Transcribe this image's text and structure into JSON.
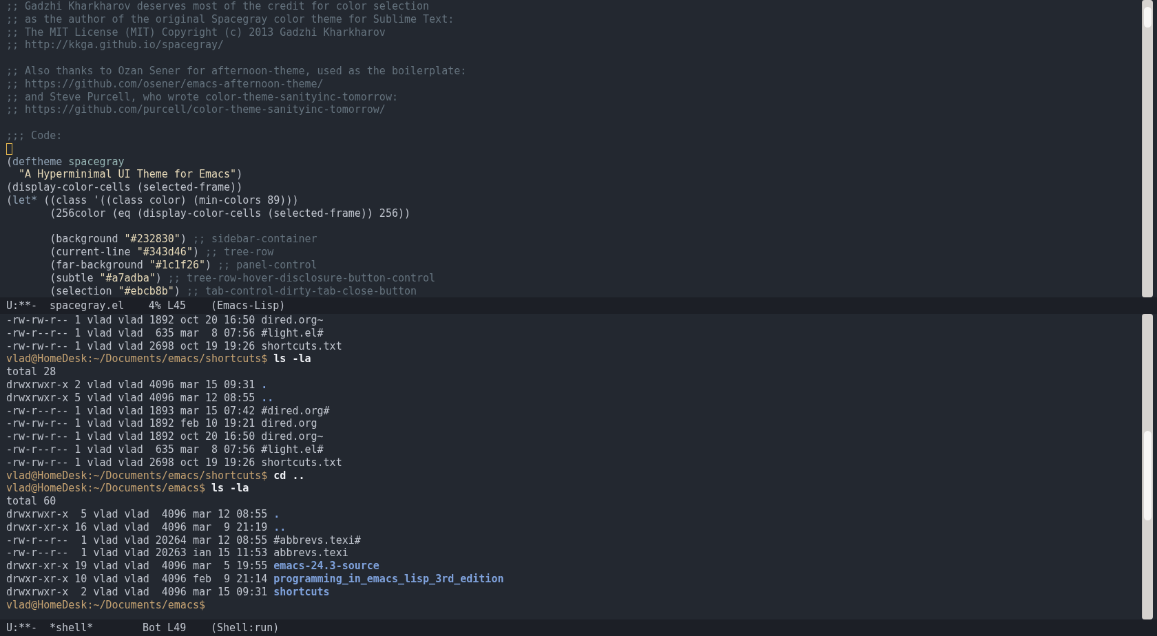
{
  "editor": {
    "lines": [
      {
        "kind": "text",
        "segments": [
          {
            "kind": "comment",
            "text": ";; Gadzhi Kharkharov deserves most of the credit for color selection"
          }
        ]
      },
      {
        "kind": "text",
        "segments": [
          {
            "kind": "comment",
            "text": ";; as the author of the original Spacegray color theme for Sublime Text:"
          }
        ]
      },
      {
        "kind": "text",
        "segments": [
          {
            "kind": "comment",
            "text": ";; The MIT License (MIT) Copyright (c) 2013 Gadzhi Kharkharov"
          }
        ]
      },
      {
        "kind": "text",
        "segments": [
          {
            "kind": "comment",
            "text": ";; http://kkga.github.io/spacegray/"
          }
        ]
      },
      {
        "kind": "blank"
      },
      {
        "kind": "text",
        "segments": [
          {
            "kind": "comment",
            "text": ";; Also thanks to Ozan Sener for afternoon-theme, used as the boilerplate:"
          }
        ]
      },
      {
        "kind": "text",
        "segments": [
          {
            "kind": "comment",
            "text": ";; https://github.com/osener/emacs-afternoon-theme/"
          }
        ]
      },
      {
        "kind": "text",
        "segments": [
          {
            "kind": "comment",
            "text": ";; and Steve Purcell, who wrote color-theme-sanityinc-tomorrow:"
          }
        ]
      },
      {
        "kind": "text",
        "segments": [
          {
            "kind": "comment",
            "text": ";; https://github.com/purcell/color-theme-sanityinc-tomorrow/"
          }
        ]
      },
      {
        "kind": "blank"
      },
      {
        "kind": "text",
        "segments": [
          {
            "kind": "comment",
            "text": ";;; Code:"
          }
        ]
      },
      {
        "kind": "cursor"
      },
      {
        "kind": "text",
        "segments": [
          {
            "kind": "plain",
            "text": "("
          },
          {
            "kind": "keyword",
            "text": "deftheme "
          },
          {
            "kind": "name",
            "text": "spacegray"
          }
        ]
      },
      {
        "kind": "text",
        "segments": [
          {
            "kind": "string",
            "text": "  \"A Hyperminimal UI Theme for Emacs\""
          },
          {
            "kind": "plain",
            "text": ")"
          }
        ]
      },
      {
        "kind": "text",
        "segments": [
          {
            "kind": "plain",
            "text": "(display-color-cells (selected-frame))"
          }
        ]
      },
      {
        "kind": "text",
        "segments": [
          {
            "kind": "plain",
            "text": "("
          },
          {
            "kind": "keyword",
            "text": "let*"
          },
          {
            "kind": "plain",
            "text": " ((class '((class color) (min-colors 89)))"
          }
        ]
      },
      {
        "kind": "text",
        "segments": [
          {
            "kind": "plain",
            "text": "       (256color (eq (display-color-cells (selected-frame)) 256))"
          }
        ]
      },
      {
        "kind": "blank"
      },
      {
        "kind": "text",
        "segments": [
          {
            "kind": "plain",
            "text": "       (background "
          },
          {
            "kind": "string",
            "text": "\"#232830\""
          },
          {
            "kind": "plain",
            "text": ") "
          },
          {
            "kind": "comment",
            "text": ";; sidebar-container"
          }
        ]
      },
      {
        "kind": "text",
        "segments": [
          {
            "kind": "plain",
            "text": "       (current-line "
          },
          {
            "kind": "string",
            "text": "\"#343d46\""
          },
          {
            "kind": "plain",
            "text": ") "
          },
          {
            "kind": "comment",
            "text": ";; tree-row"
          }
        ]
      },
      {
        "kind": "text",
        "segments": [
          {
            "kind": "plain",
            "text": "       (far-background "
          },
          {
            "kind": "string",
            "text": "\"#1c1f26\""
          },
          {
            "kind": "plain",
            "text": ") "
          },
          {
            "kind": "comment",
            "text": ";; panel-control"
          }
        ]
      },
      {
        "kind": "text",
        "segments": [
          {
            "kind": "plain",
            "text": "       (subtle "
          },
          {
            "kind": "string",
            "text": "\"#a7adba\""
          },
          {
            "kind": "plain",
            "text": ") "
          },
          {
            "kind": "comment",
            "text": ";; tree-row-hover-disclosure-button-control"
          }
        ]
      },
      {
        "kind": "text",
        "segments": [
          {
            "kind": "plain",
            "text": "       (selection "
          },
          {
            "kind": "string",
            "text": "\"#ebcb8b\""
          },
          {
            "kind": "plain",
            "text": ") "
          },
          {
            "kind": "comment",
            "text": ";; tab-control-dirty-tab-close-button"
          }
        ]
      }
    ],
    "mode_line": {
      "status": "U:**-",
      "buffer": "spacegray.el",
      "position": "4% L45",
      "mode": "(Emacs-Lisp)"
    }
  },
  "shell": {
    "lines": [
      {
        "kind": "text",
        "segments": [
          {
            "kind": "plain",
            "text": "-rw-rw-r-- 1 vlad vlad 1892 oct 20 16:50 dired.org~"
          }
        ]
      },
      {
        "kind": "text",
        "segments": [
          {
            "kind": "plain",
            "text": "-rw-r--r-- 1 vlad vlad  635 mar  8 07:56 #light.el#"
          }
        ]
      },
      {
        "kind": "text",
        "segments": [
          {
            "kind": "plain",
            "text": "-rw-rw-r-- 1 vlad vlad 2698 oct 19 19:26 shortcuts.txt"
          }
        ]
      },
      {
        "kind": "text",
        "segments": [
          {
            "kind": "prompt",
            "text": "vlad@HomeDesk:~/Documents/emacs/shortcuts$ "
          },
          {
            "kind": "command",
            "text": "ls -la"
          }
        ]
      },
      {
        "kind": "text",
        "segments": [
          {
            "kind": "plain",
            "text": "total 28"
          }
        ]
      },
      {
        "kind": "text",
        "segments": [
          {
            "kind": "plain",
            "text": "drwxrwxr-x 2 vlad vlad 4096 mar 15 09:31 "
          },
          {
            "kind": "directory",
            "text": "."
          }
        ]
      },
      {
        "kind": "text",
        "segments": [
          {
            "kind": "plain",
            "text": "drwxrwxr-x 5 vlad vlad 4096 mar 12 08:55 "
          },
          {
            "kind": "directory",
            "text": ".."
          }
        ]
      },
      {
        "kind": "text",
        "segments": [
          {
            "kind": "plain",
            "text": "-rw-r--r-- 1 vlad vlad 1893 mar 15 07:42 #dired.org#"
          }
        ]
      },
      {
        "kind": "text",
        "segments": [
          {
            "kind": "plain",
            "text": "-rw-rw-r-- 1 vlad vlad 1892 feb 10 19:21 dired.org"
          }
        ]
      },
      {
        "kind": "text",
        "segments": [
          {
            "kind": "plain",
            "text": "-rw-rw-r-- 1 vlad vlad 1892 oct 20 16:50 dired.org~"
          }
        ]
      },
      {
        "kind": "text",
        "segments": [
          {
            "kind": "plain",
            "text": "-rw-r--r-- 1 vlad vlad  635 mar  8 07:56 #light.el#"
          }
        ]
      },
      {
        "kind": "text",
        "segments": [
          {
            "kind": "plain",
            "text": "-rw-rw-r-- 1 vlad vlad 2698 oct 19 19:26 shortcuts.txt"
          }
        ]
      },
      {
        "kind": "text",
        "segments": [
          {
            "kind": "prompt",
            "text": "vlad@HomeDesk:~/Documents/emacs/shortcuts$ "
          },
          {
            "kind": "command",
            "text": "cd .."
          }
        ]
      },
      {
        "kind": "text",
        "segments": [
          {
            "kind": "prompt",
            "text": "vlad@HomeDesk:~/Documents/emacs$ "
          },
          {
            "kind": "command",
            "text": "ls -la"
          }
        ]
      },
      {
        "kind": "text",
        "segments": [
          {
            "kind": "plain",
            "text": "total 60"
          }
        ]
      },
      {
        "kind": "text",
        "segments": [
          {
            "kind": "plain",
            "text": "drwxrwxr-x  5 vlad vlad  4096 mar 12 08:55 "
          },
          {
            "kind": "directory",
            "text": "."
          }
        ]
      },
      {
        "kind": "text",
        "segments": [
          {
            "kind": "plain",
            "text": "drwxr-xr-x 16 vlad vlad  4096 mar  9 21:19 "
          },
          {
            "kind": "directory",
            "text": ".."
          }
        ]
      },
      {
        "kind": "text",
        "segments": [
          {
            "kind": "plain",
            "text": "-rw-r--r--  1 vlad vlad 20264 mar 12 08:55 #abbrevs.texi#"
          }
        ]
      },
      {
        "kind": "text",
        "segments": [
          {
            "kind": "plain",
            "text": "-rw-r--r--  1 vlad vlad 20263 ian 15 11:53 abbrevs.texi"
          }
        ]
      },
      {
        "kind": "text",
        "segments": [
          {
            "kind": "plain",
            "text": "drwxr-xr-x 19 vlad vlad  4096 mar  5 19:55 "
          },
          {
            "kind": "directory",
            "text": "emacs-24.3-source"
          }
        ]
      },
      {
        "kind": "text",
        "segments": [
          {
            "kind": "plain",
            "text": "drwxr-xr-x 10 vlad vlad  4096 feb  9 21:14 "
          },
          {
            "kind": "directory",
            "text": "programming_in_emacs_lisp_3rd_edition"
          }
        ]
      },
      {
        "kind": "text",
        "segments": [
          {
            "kind": "plain",
            "text": "drwxrwxr-x  2 vlad vlad  4096 mar 15 09:31 "
          },
          {
            "kind": "directory",
            "text": "shortcuts"
          }
        ]
      },
      {
        "kind": "text",
        "segments": [
          {
            "kind": "prompt",
            "text": "vlad@HomeDesk:~/Documents/emacs$"
          }
        ]
      }
    ],
    "mode_line": {
      "status": "U:**-",
      "buffer": "*shell*",
      "position": "Bot L49",
      "mode": "(Shell:run)"
    }
  }
}
